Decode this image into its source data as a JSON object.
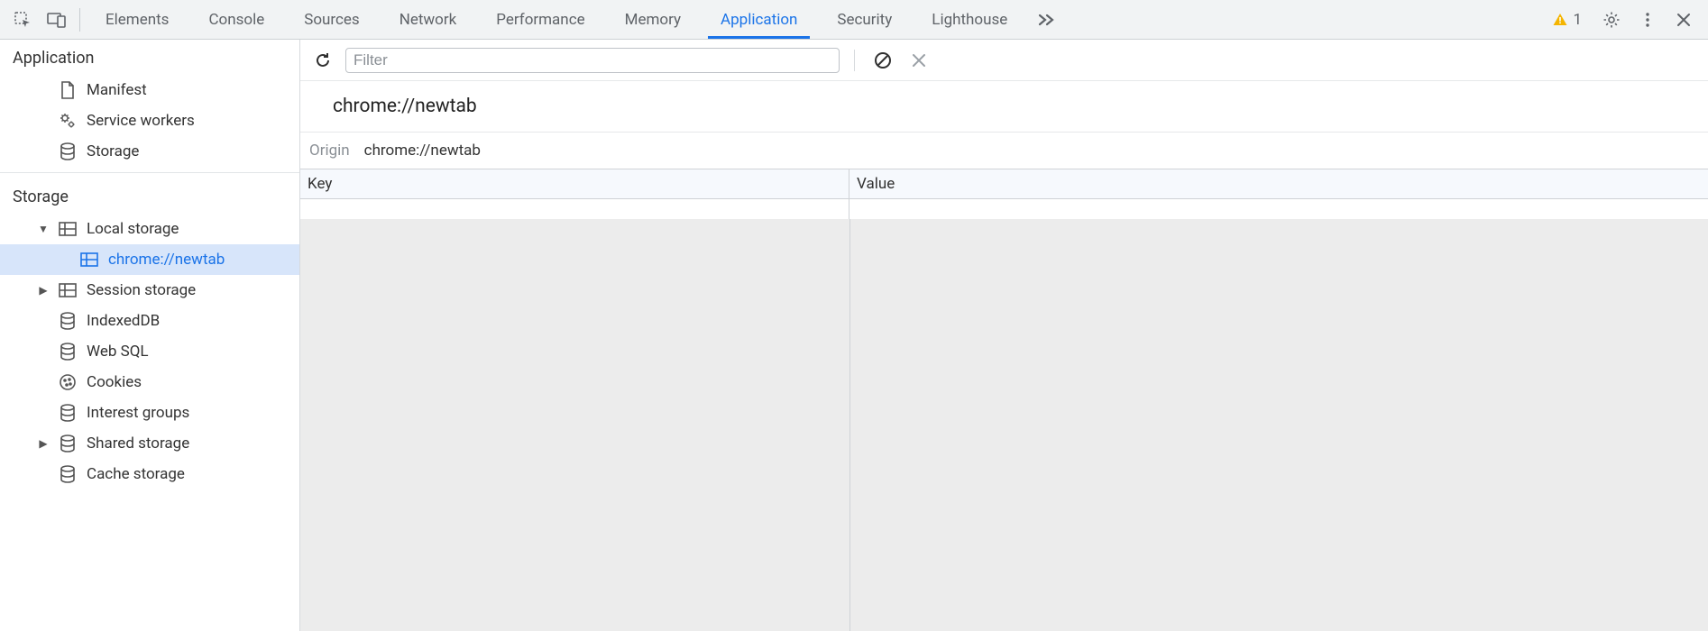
{
  "tabstrip": {
    "tabs": [
      {
        "label": "Elements",
        "active": false
      },
      {
        "label": "Console",
        "active": false
      },
      {
        "label": "Sources",
        "active": false
      },
      {
        "label": "Network",
        "active": false
      },
      {
        "label": "Performance",
        "active": false
      },
      {
        "label": "Memory",
        "active": false
      },
      {
        "label": "Application",
        "active": true
      },
      {
        "label": "Security",
        "active": false
      },
      {
        "label": "Lighthouse",
        "active": false
      }
    ],
    "warnings_count": "1"
  },
  "sidebar": {
    "sections": {
      "application": {
        "title": "Application",
        "items": [
          {
            "icon": "file",
            "label": "Manifest"
          },
          {
            "icon": "gear-mini",
            "label": "Service workers"
          },
          {
            "icon": "db",
            "label": "Storage"
          }
        ]
      },
      "storage": {
        "title": "Storage",
        "items": [
          {
            "arrow": "down",
            "icon": "grid",
            "label": "Local storage",
            "indent": 1
          },
          {
            "arrow": "",
            "icon": "grid",
            "label": "chrome://newtab",
            "indent": 2,
            "selected": true
          },
          {
            "arrow": "right",
            "icon": "grid",
            "label": "Session storage",
            "indent": 1
          },
          {
            "arrow": "",
            "icon": "db",
            "label": "IndexedDB",
            "indent": 1
          },
          {
            "arrow": "",
            "icon": "db",
            "label": "Web SQL",
            "indent": 1
          },
          {
            "arrow": "",
            "icon": "cookie",
            "label": "Cookies",
            "indent": 1
          },
          {
            "arrow": "",
            "icon": "db",
            "label": "Interest groups",
            "indent": 1
          },
          {
            "arrow": "right",
            "icon": "db",
            "label": "Shared storage",
            "indent": 1
          },
          {
            "arrow": "",
            "icon": "db",
            "label": "Cache storage",
            "indent": 1
          }
        ]
      }
    }
  },
  "toolbar": {
    "filter_placeholder": "Filter"
  },
  "detail": {
    "title": "chrome://newtab",
    "origin_label": "Origin",
    "origin_value": "chrome://newtab"
  },
  "table": {
    "columns": [
      "Key",
      "Value"
    ],
    "rows": []
  }
}
